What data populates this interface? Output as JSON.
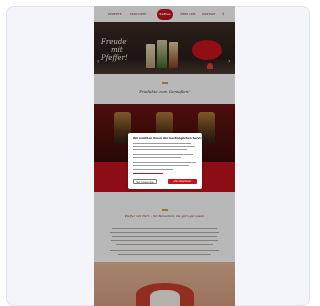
{
  "nav": {
    "items": [
      "REZEPTE",
      "PRODUKTE",
      "ÜBER UNS",
      "KONTAKT"
    ],
    "logo": "Kattus",
    "search_icon": "search-icon"
  },
  "hero": {
    "title_line1": "Freude",
    "title_line2": "mit",
    "title_line3": "Pfeffer!"
  },
  "products": {
    "heading": "Produkte zum Genießen!"
  },
  "cookie": {
    "title": "Wir möchten Ihnen den bestmöglichen Service bieten",
    "reject": "Nur notwendige",
    "accept": "Alle akzeptieren"
  },
  "band": {
    "button": "ZUM SHOP"
  },
  "story": {
    "heading": "Pfeffer mit Herz – für Menschen, die gern gut essen"
  },
  "colors": {
    "brand_red": "#c4141c",
    "dark_brown": "#2a1e19"
  }
}
